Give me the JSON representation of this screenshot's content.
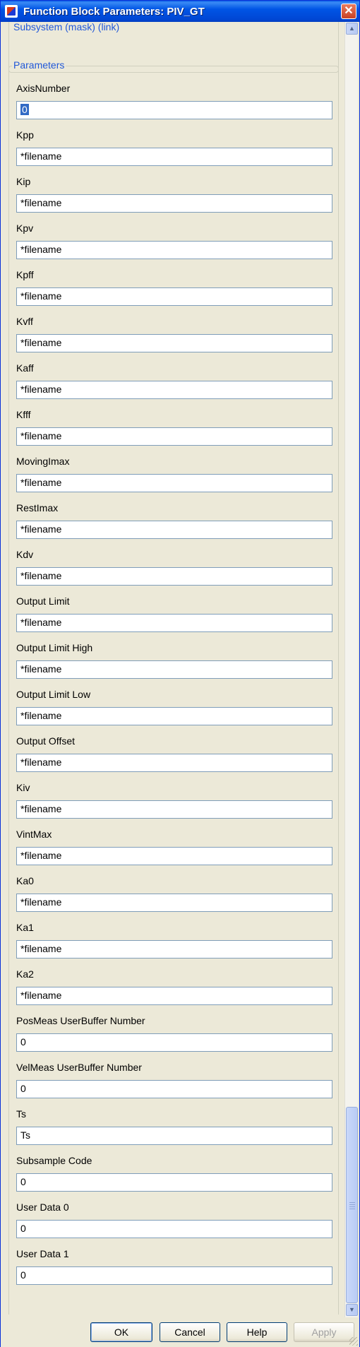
{
  "window": {
    "title": "Function Block Parameters: PIV_GT",
    "close_glyph": "✕"
  },
  "subsystem": {
    "label": "Subsystem (mask) (link)"
  },
  "parameters": {
    "label": "Parameters",
    "fields": [
      {
        "label": "AxisNumber",
        "value": "0",
        "selected": true
      },
      {
        "label": "Kpp",
        "value": "*filename"
      },
      {
        "label": "Kip",
        "value": "*filename"
      },
      {
        "label": "Kpv",
        "value": "*filename"
      },
      {
        "label": "Kpff",
        "value": "*filename"
      },
      {
        "label": "Kvff",
        "value": "*filename"
      },
      {
        "label": "Kaff",
        "value": "*filename"
      },
      {
        "label": "Kfff",
        "value": "*filename"
      },
      {
        "label": "MovingImax",
        "value": "*filename"
      },
      {
        "label": "RestImax",
        "value": "*filename"
      },
      {
        "label": "Kdv",
        "value": "*filename"
      },
      {
        "label": "Output Limit",
        "value": "*filename"
      },
      {
        "label": "Output Limit High",
        "value": "*filename"
      },
      {
        "label": "Output Limit Low",
        "value": "*filename"
      },
      {
        "label": "Output Offset",
        "value": "*filename"
      },
      {
        "label": "Kiv",
        "value": "*filename"
      },
      {
        "label": "VintMax",
        "value": "*filename"
      },
      {
        "label": "Ka0",
        "value": "*filename"
      },
      {
        "label": "Ka1",
        "value": "*filename"
      },
      {
        "label": "Ka2",
        "value": "*filename"
      },
      {
        "label": "PosMeas UserBuffer Number",
        "value": "0"
      },
      {
        "label": "VelMeas UserBuffer Number",
        "value": "0"
      },
      {
        "label": "Ts",
        "value": "Ts"
      },
      {
        "label": "Subsample Code",
        "value": "0"
      },
      {
        "label": "User Data 0",
        "value": "0"
      },
      {
        "label": "User Data 1",
        "value": "0"
      }
    ]
  },
  "buttons": {
    "ok": "OK",
    "cancel": "Cancel",
    "help": "Help",
    "apply": "Apply"
  },
  "scrollbar": {
    "up_glyph": "▲",
    "down_glyph": "▼",
    "position_fraction": 0.84
  }
}
